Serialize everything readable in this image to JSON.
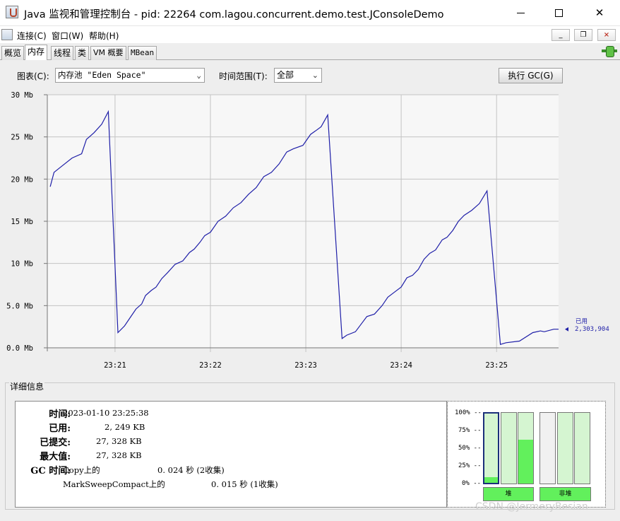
{
  "window": {
    "title": "Java 监视和管理控制台 - pid: 22264 com.lagou.concurrent.demo.test.JConsoleDemo",
    "min": "—",
    "max": "☐",
    "close": "✕"
  },
  "menu": {
    "connect": "连接(C)",
    "window": "窗口(W)",
    "help": "帮助(H)",
    "mdi_min": "_",
    "mdi_restore": "❐",
    "mdi_close": "×"
  },
  "tabs": [
    "概览",
    "内存",
    "线程",
    "类",
    "VM 概要",
    "MBean"
  ],
  "active_tab": "内存",
  "controls": {
    "chart_label": "图表(C):",
    "chart_value": "内存池 \"Eden Space\"",
    "time_range_label": "时间范围(T):",
    "time_range_value": "全部",
    "gc_button": "执行 GC(G)"
  },
  "chart_data": {
    "type": "line",
    "y_tick_labels": [
      "0.0 Mb",
      "5.0 Mb",
      "10 Mb",
      "15 Mb",
      "20 Mb",
      "25 Mb",
      "30 Mb"
    ],
    "y_ticks": [
      0,
      5,
      10,
      15,
      20,
      25,
      30
    ],
    "ylim": [
      0,
      30
    ],
    "x_tick_labels": [
      "23:21",
      "23:22",
      "23:23",
      "23:24",
      "23:25"
    ],
    "x_ticks": [
      1.0,
      2.0,
      3.0,
      4.0,
      5.0
    ],
    "xlim": [
      0.29,
      5.65
    ],
    "grid": true,
    "line_color": "#1f1fa8",
    "series": [
      {
        "name": "已用",
        "current_value_label": "2,303,904",
        "x": [
          0.32,
          0.36,
          0.45,
          0.55,
          0.65,
          0.7,
          0.78,
          0.86,
          0.93,
          1.03,
          1.1,
          1.16,
          1.22,
          1.28,
          1.32,
          1.38,
          1.43,
          1.49,
          1.55,
          1.63,
          1.71,
          1.78,
          1.83,
          1.89,
          1.94,
          2.0,
          2.08,
          2.16,
          2.24,
          2.32,
          2.4,
          2.48,
          2.56,
          2.64,
          2.72,
          2.8,
          2.87,
          2.97,
          3.05,
          3.1,
          3.16,
          3.23,
          3.38,
          3.43,
          3.52,
          3.64,
          3.72,
          3.8,
          3.86,
          3.93,
          4.0,
          4.06,
          4.12,
          4.18,
          4.24,
          4.3,
          4.36,
          4.43,
          4.48,
          4.54,
          4.6,
          4.66,
          4.74,
          4.82,
          4.9,
          5.04,
          5.1,
          5.24,
          5.38,
          5.46,
          5.5,
          5.6,
          5.65
        ],
        "y": [
          19.1,
          20.8,
          21.6,
          22.5,
          23.0,
          24.7,
          25.5,
          26.5,
          28.0,
          1.8,
          2.6,
          3.6,
          4.6,
          5.2,
          6.2,
          6.8,
          7.2,
          8.2,
          8.9,
          9.9,
          10.3,
          11.3,
          11.7,
          12.5,
          13.3,
          13.7,
          15.0,
          15.6,
          16.6,
          17.2,
          18.2,
          19.0,
          20.3,
          20.8,
          21.8,
          23.2,
          23.6,
          24.0,
          25.3,
          25.7,
          26.2,
          27.6,
          1.1,
          1.5,
          1.9,
          3.7,
          4.0,
          5.0,
          6.0,
          6.6,
          7.2,
          8.3,
          8.6,
          9.3,
          10.5,
          11.2,
          11.6,
          12.8,
          13.1,
          13.9,
          15.0,
          15.7,
          16.3,
          17.1,
          18.6,
          0.4,
          0.6,
          0.8,
          1.8,
          2.0,
          1.9,
          2.2,
          2.2
        ]
      }
    ]
  },
  "details": {
    "title": "详细信息",
    "time_label": "时间:",
    "time_value": "2023-01-10 23:25:38",
    "used_label": "已用:",
    "used_value": "2, 249 KB",
    "committed_label": "已提交:",
    "committed_value": "27, 328 KB",
    "max_label": "最大值:",
    "max_value": "27, 328 KB",
    "gc_label": "GC 时间:",
    "gc_rows": [
      {
        "name": "Copy上的",
        "time": "0. 024 秒 (2收集)"
      },
      {
        "name": "MarkSweepCompact上的",
        "time": "0. 015 秒 (1收集)"
      }
    ]
  },
  "pools": {
    "pct_labels": [
      "100% --",
      "75% --",
      "50% --",
      "25% --",
      "0% --"
    ],
    "bars": [
      {
        "fill_fraction": 0.08,
        "selected": true,
        "group": "heap"
      },
      {
        "fill_fraction": 0.0,
        "selected": false,
        "group": "heap"
      },
      {
        "fill_fraction": 0.62,
        "selected": false,
        "group": "heap"
      },
      {
        "fill_fraction": 0.0,
        "selected": false,
        "group": "nonheap",
        "empty": true
      },
      {
        "fill_fraction": 0.0,
        "selected": false,
        "group": "nonheap"
      },
      {
        "fill_fraction": 0.0,
        "selected": false,
        "group": "nonheap"
      }
    ],
    "heap_label": "堆",
    "nonheap_label": "非堆"
  },
  "watermark": "CSDN @JermeryBesian"
}
